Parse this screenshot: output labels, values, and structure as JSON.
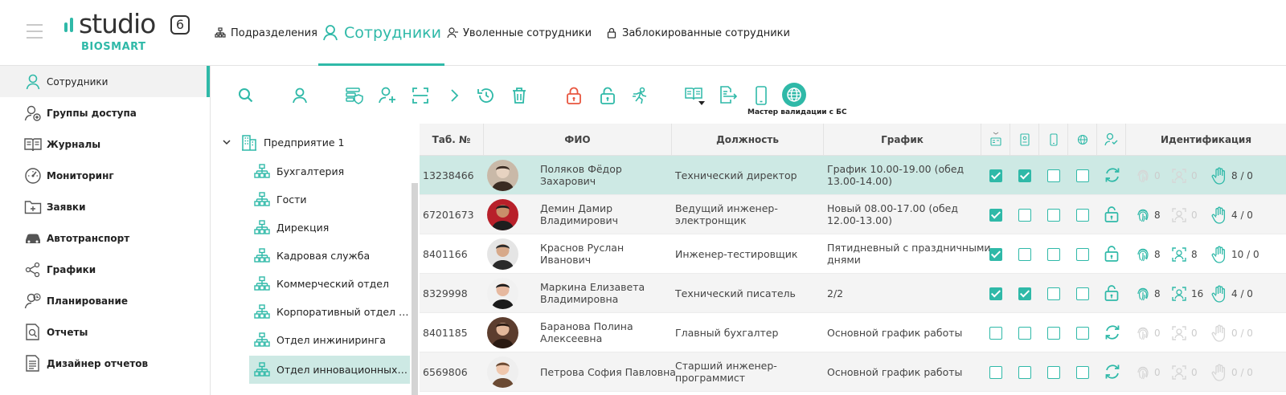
{
  "header": {
    "brand_word": "studio",
    "brand_version": "6",
    "brand_sub": "BIOSMART",
    "tabs": [
      {
        "label": "Подразделения"
      },
      {
        "label": "Сотрудники"
      },
      {
        "label": "Уволенные сотрудники"
      },
      {
        "label": "Заблокированные сотрудники"
      }
    ]
  },
  "sidebar": {
    "items": [
      {
        "label": "Сотрудники",
        "icon": "person-icon"
      },
      {
        "label": "Группы доступа",
        "icon": "access-group-icon"
      },
      {
        "label": "Журналы",
        "icon": "journal-icon"
      },
      {
        "label": "Мониторинг",
        "icon": "gauge-icon"
      },
      {
        "label": "Заявки",
        "icon": "folder-plus-icon"
      },
      {
        "label": "Автотранспорт",
        "icon": "car-icon"
      },
      {
        "label": "Графики",
        "icon": "share-graph-icon"
      },
      {
        "label": "Планирование",
        "icon": "person-clock-icon"
      },
      {
        "label": "Отчеты",
        "icon": "report-search-icon"
      },
      {
        "label": "Дизайнер отчетов",
        "icon": "report-designer-icon"
      }
    ]
  },
  "toolbar": {
    "validation_label": "Мастер валидации с БС"
  },
  "tree": {
    "root": "Предприятие 1",
    "nodes": [
      "Бухгалтерия",
      "Гости",
      "Дирекция",
      "Кадровая служба",
      "Коммерческий отдел",
      "Корпоративный отдел п...",
      "Отдел инжиниринга",
      "Отдел инновационных р..."
    ]
  },
  "grid": {
    "columns": {
      "tab": "Таб. №",
      "fio": "ФИО",
      "position": "Должность",
      "schedule": "График",
      "ident": "Идентификация"
    },
    "rows": [
      {
        "tab": "13238466",
        "fio1": "Поляков Фёдор",
        "fio2": "Захарович",
        "position1": "Технический директор",
        "position2": "",
        "schedule1": "График 10.00-19.00 (обед",
        "schedule2": "13.00-14.00)",
        "c1": true,
        "c2": true,
        "c3": false,
        "c4": false,
        "lock": "sync",
        "fp": "0",
        "face": "0",
        "palm": "8 / 0",
        "fp_on": false,
        "face_on": false,
        "palm_on": true
      },
      {
        "tab": "67201673",
        "fio1": "Демин  Дамир",
        "fio2": "Владимирович",
        "position1": "Ведущий инженер-",
        "position2": "электронщик",
        "schedule1": "Новый 08.00-17.00 (обед",
        "schedule2": "12.00-13.00)",
        "c1": true,
        "c2": false,
        "c3": false,
        "c4": false,
        "lock": "lock",
        "fp": "8",
        "face": "0",
        "palm": "4 / 0",
        "fp_on": true,
        "face_on": false,
        "palm_on": true
      },
      {
        "tab": "8401166",
        "fio1": "Краснов  Руслан",
        "fio2": "Иванович",
        "position1": "Инженер-тестировщик",
        "position2": "",
        "schedule1": "Пятидневный с праздничными",
        "schedule2": "днями",
        "c1": true,
        "c2": false,
        "c3": false,
        "c4": false,
        "lock": "lock",
        "fp": "8",
        "face": "8",
        "palm": "10 / 0",
        "fp_on": true,
        "face_on": true,
        "palm_on": true
      },
      {
        "tab": "8329998",
        "fio1": "Маркина Елизавета",
        "fio2": "Владимировна",
        "position1": "Технический писатель",
        "position2": "",
        "schedule1": "2/2",
        "schedule2": "",
        "c1": true,
        "c2": true,
        "c3": false,
        "c4": false,
        "lock": "lock",
        "fp": "8",
        "face": "16",
        "palm": "4 / 0",
        "fp_on": true,
        "face_on": true,
        "palm_on": true
      },
      {
        "tab": "8401185",
        "fio1": "Баранова Полина",
        "fio2": "Алексеевна",
        "position1": "Главный бухгалтер",
        "position2": "",
        "schedule1": "Основной график работы",
        "schedule2": "",
        "c1": false,
        "c2": false,
        "c3": false,
        "c4": false,
        "lock": "sync",
        "fp": "0",
        "face": "0",
        "palm": "0 / 0",
        "fp_on": false,
        "face_on": false,
        "palm_on": false
      },
      {
        "tab": "6569806",
        "fio1": "Петрова София  Павловна",
        "fio2": "",
        "position1": "Старший инженер-",
        "position2": "программист",
        "schedule1": "Основной график работы",
        "schedule2": "",
        "c1": false,
        "c2": false,
        "c3": false,
        "c4": false,
        "lock": "sync",
        "fp": "0",
        "face": "0",
        "palm": "0 / 0",
        "fp_on": false,
        "face_on": false,
        "palm_on": false
      }
    ]
  },
  "colors": {
    "accent": "#2fb9a8",
    "danger": "#e8563f",
    "selected_row": "#cde9e4"
  }
}
